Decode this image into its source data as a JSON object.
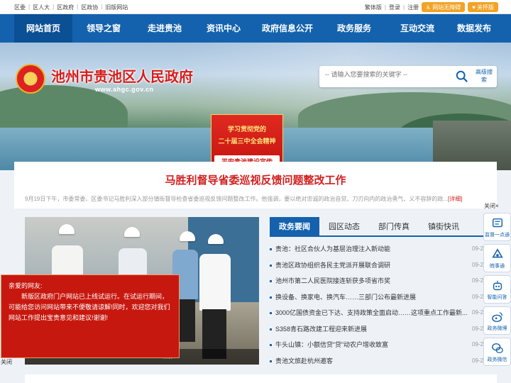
{
  "topbar": {
    "left_links": [
      "区委",
      "区人大",
      "区政府",
      "区政协",
      "旧版网站"
    ],
    "right_links": [
      "繁体版",
      "登录",
      "注册"
    ],
    "accessible_btn": "网站无障碍",
    "care_btn": "关怀版"
  },
  "nav": {
    "items": [
      "网站首页",
      "领导之窗",
      "走进贵池",
      "资讯中心",
      "政府信息公开",
      "政务服务",
      "互动交流",
      "数据发布"
    ],
    "active_index": 0
  },
  "header": {
    "title": "池州市贵池区人民政府",
    "url": "www.ahgc.gov.cn"
  },
  "search": {
    "placeholder": "-- 请输入您要搜索的关键字 --",
    "advanced_label": "高级搜索"
  },
  "promo": {
    "line1": "学习贯彻党的",
    "line2": "二十届三中全会精神",
    "line3": "平安贵池建设宣传"
  },
  "headline": {
    "title": "马胜利督导省委巡视反馈问题整改工作",
    "summary": "9月19日下午，市委常委、区委书记马胜利深入部分镇街督导检查省委巡视反馈问题整改工作。他强调，要以绝对忠诚的政治自觉、刀刃向内的政治勇气、义不容辞的政...",
    "more": "[详细]"
  },
  "photo": {
    "caption_tail": "工作"
  },
  "tabs": {
    "items": [
      "政务要闻",
      "园区动态",
      "部门传真",
      "镇街快讯"
    ],
    "active_index": 0
  },
  "news": [
    {
      "title": "贵池：社区合伙人为基层治理注入新动能",
      "date": "09-2"
    },
    {
      "title": "贵池区政协组织各民主党派开展联合调研",
      "date": "09-2"
    },
    {
      "title": "池州市第二人民医院接连斩获多项省市奖",
      "date": "09-2"
    },
    {
      "title": "换设备、换家电、换汽车……三部门公布最新进展",
      "date": "09-2"
    },
    {
      "title": "3000亿国债资金已下达、支持政策全面启动……这项重点工作最新...",
      "date": "09-2"
    },
    {
      "title": "S358青石路改建工程迎来新进展",
      "date": "09-2"
    },
    {
      "title": "牛头山镇：小额信贷“贷”动农户增收致富",
      "date": "09-2"
    },
    {
      "title": "贵池文旅赴杭州邀客",
      "date": "09-2"
    }
  ],
  "sidebar": {
    "close_label": "关闭×",
    "items": [
      "监督一点通",
      "皖事通",
      "智能问答",
      "政务微博",
      "政务微信"
    ]
  },
  "notice": {
    "greeting": "亲爱的网友:",
    "body": "新版区政府门户网站已上线试运行。在试运行期间，可能给您访问网站带来不便敬请谅解!同时，欢迎您对我们网站工作提出宝贵意见和建议!谢谢!",
    "close_label": "关闭"
  },
  "colors": {
    "brand_blue": "#1462ad",
    "accent_red": "#d11f1f",
    "accent_orange": "#f2a325"
  }
}
